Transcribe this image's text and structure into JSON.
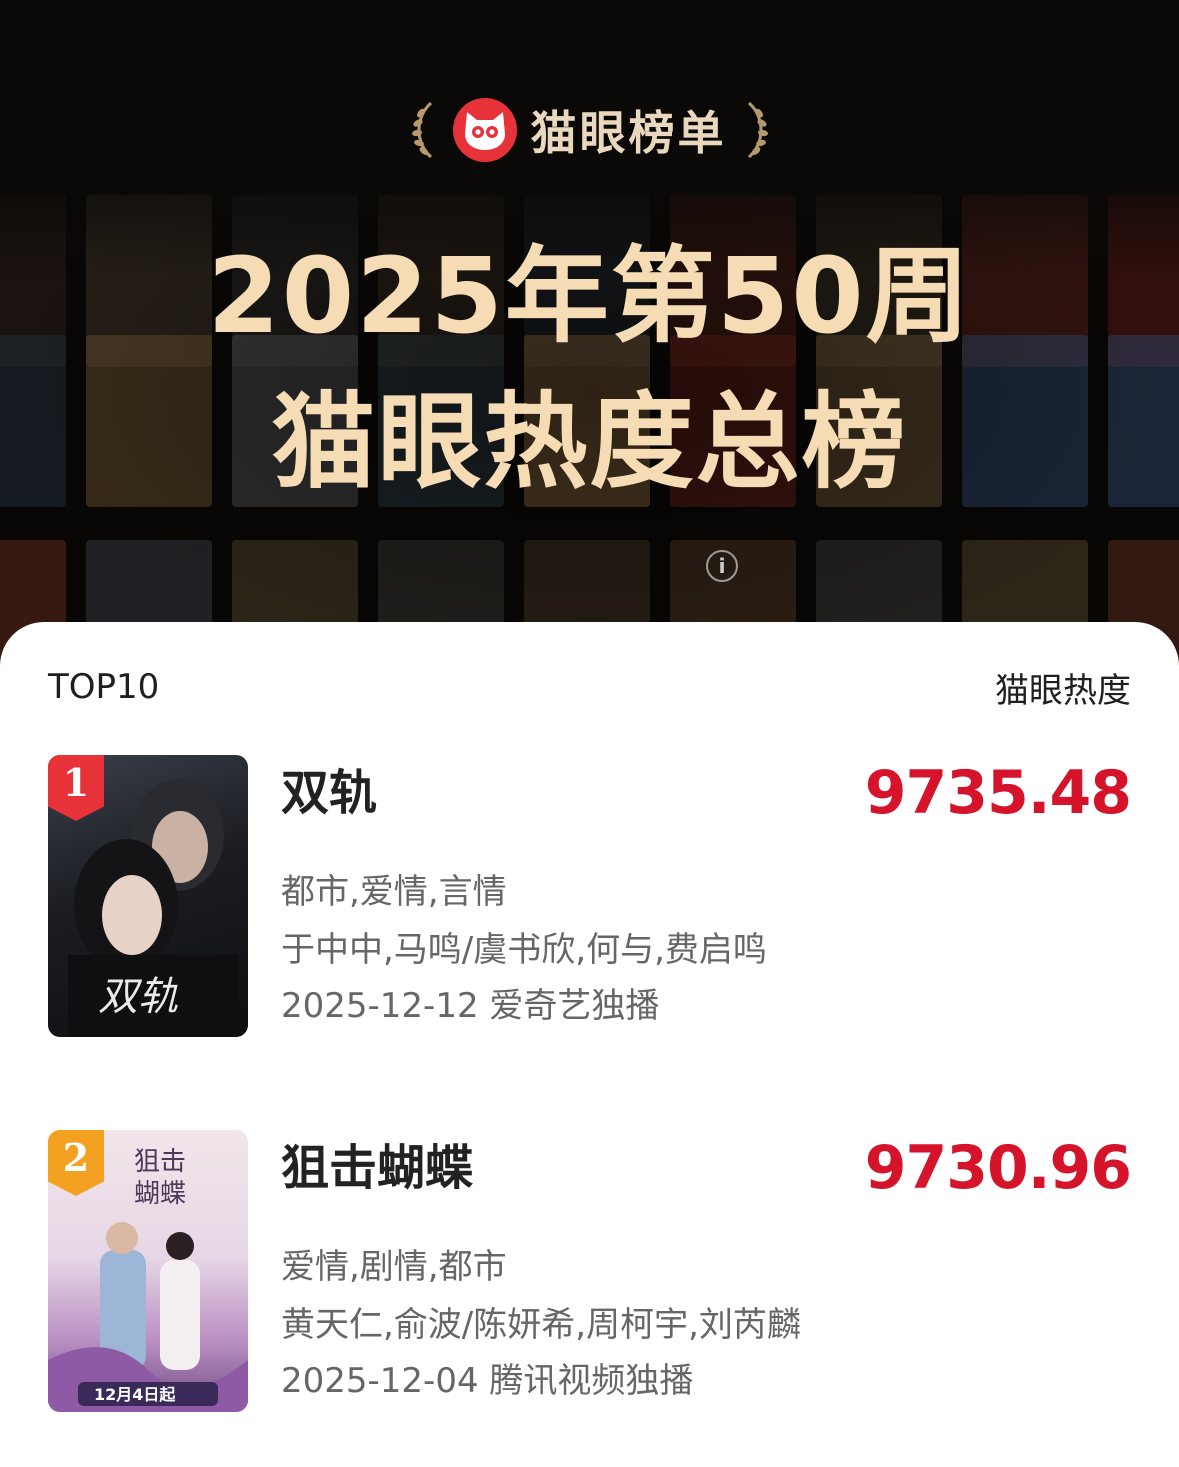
{
  "brand": {
    "name": "猫眼榜单",
    "logo_icon": "cat-face-icon",
    "accent": "#e8323a"
  },
  "hero": {
    "title_line1": "2025年第50周",
    "title_line2": "猫眼热度总榜",
    "info_icon": "info-icon",
    "title_color": "#f6dcb4"
  },
  "list": {
    "left_label": "TOP10",
    "right_label": "猫眼热度",
    "items": [
      {
        "rank": "1",
        "title": "双轨",
        "score": "9735.48",
        "genres": "都市,爱情,言情",
        "cast": "于中中,马鸣/虞书欣,何与,费启鸣",
        "release": "2025-12-12 爱奇艺独播",
        "badge_color": "#e8323a"
      },
      {
        "rank": "2",
        "title": "狙击蝴蝶",
        "score": "9730.96",
        "genres": "爱情,剧情,都市",
        "cast": "黄天仁,俞波/陈妍希,周柯宇,刘芮麟",
        "release": "2025-12-04 腾讯视频独播",
        "badge_color": "#f4a020"
      }
    ],
    "score_color": "#d5132a"
  }
}
